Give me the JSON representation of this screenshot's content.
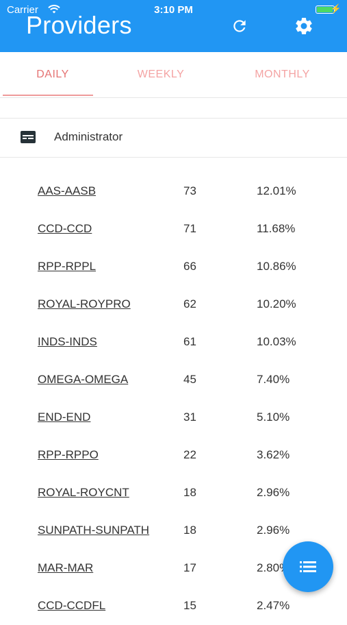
{
  "status_bar": {
    "carrier": "Carrier",
    "time": "3:10 PM",
    "battery_level": 1.0
  },
  "app_bar": {
    "title": "Providers",
    "refresh_icon": "refresh-icon",
    "settings_icon": "gear-icon"
  },
  "tabs": [
    {
      "label": "DAILY",
      "selected": true
    },
    {
      "label": "WEEKLY",
      "selected": false
    },
    {
      "label": "MONTHLY",
      "selected": false
    }
  ],
  "role": {
    "icon": "id-card-icon",
    "label": "Administrator"
  },
  "providers": [
    {
      "name": "AAS-AASB",
      "count": "73",
      "percent": "12.01%"
    },
    {
      "name": "CCD-CCD",
      "count": "71",
      "percent": "11.68%"
    },
    {
      "name": "RPP-RPPL",
      "count": "66",
      "percent": "10.86%"
    },
    {
      "name": "ROYAL-ROYPRO",
      "count": "62",
      "percent": "10.20%"
    },
    {
      "name": "INDS-INDS",
      "count": "61",
      "percent": "10.03%"
    },
    {
      "name": "OMEGA-OMEGA",
      "count": "45",
      "percent": "7.40%"
    },
    {
      "name": "END-END",
      "count": "31",
      "percent": "5.10%"
    },
    {
      "name": "RPP-RPPO",
      "count": "22",
      "percent": "3.62%"
    },
    {
      "name": "ROYAL-ROYCNT",
      "count": "18",
      "percent": "2.96%"
    },
    {
      "name": "SUNPATH-SUNPATH",
      "count": "18",
      "percent": "2.96%"
    },
    {
      "name": "MAR-MAR",
      "count": "17",
      "percent": "2.80%"
    },
    {
      "name": "CCD-CCDFL",
      "count": "15",
      "percent": "2.47%"
    }
  ],
  "fab": {
    "icon": "list-icon"
  },
  "colors": {
    "primary": "#2196f3",
    "tab_active": "#e57373",
    "tab_inactive": "#f4a3a3"
  }
}
